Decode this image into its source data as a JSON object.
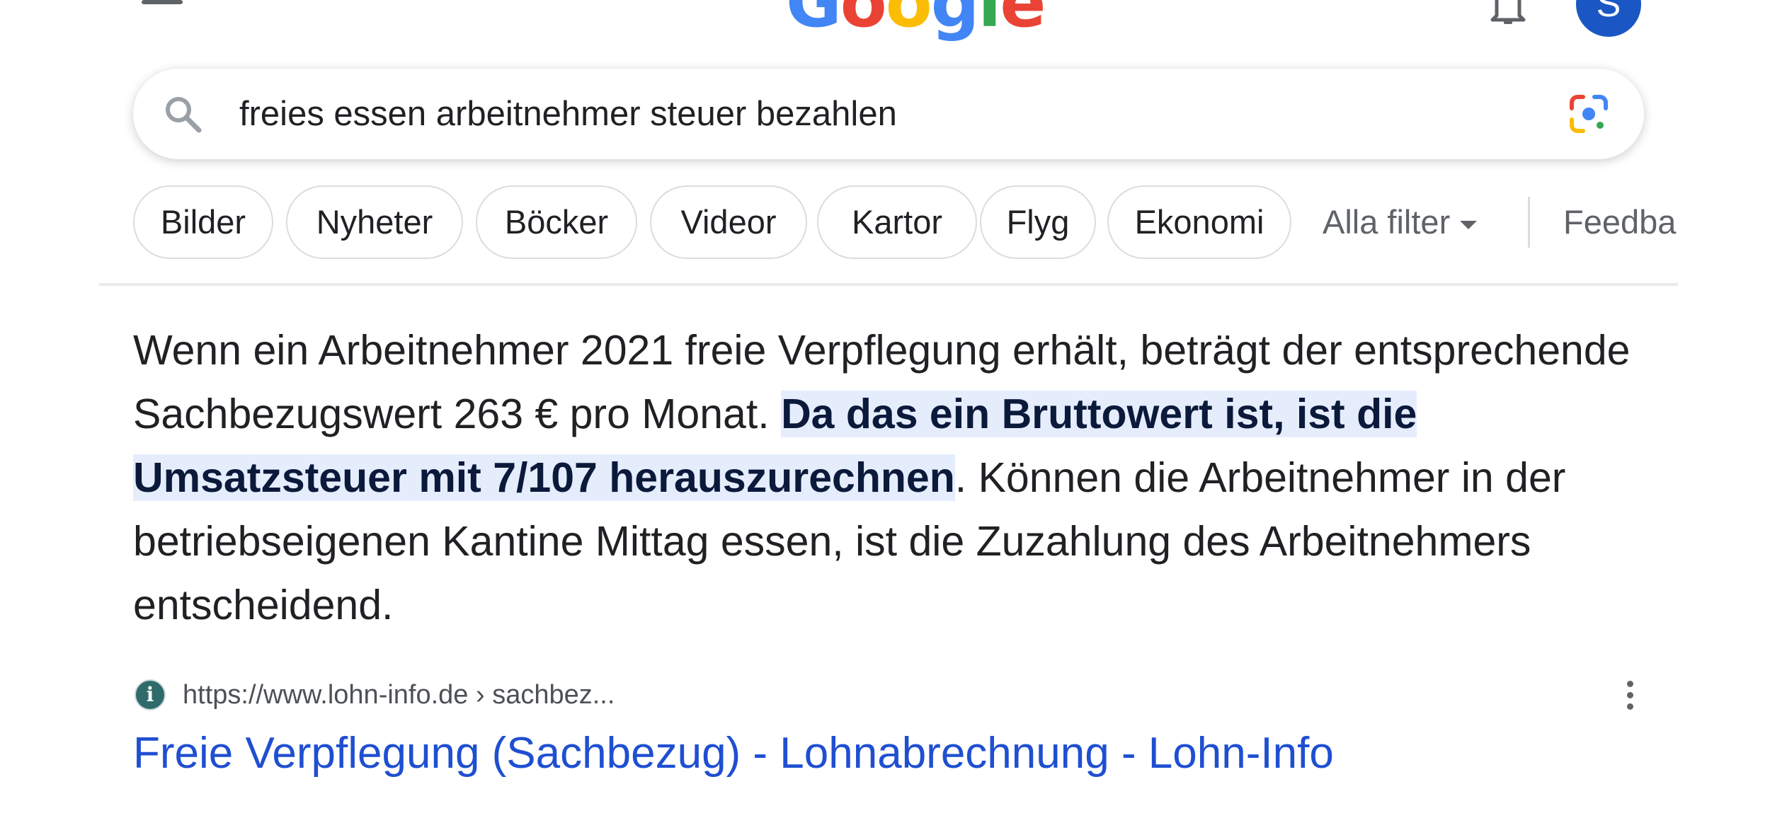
{
  "header": {
    "logo_letters": [
      "G",
      "o",
      "o",
      "g",
      "l",
      "e"
    ],
    "avatar_initial": "S"
  },
  "search": {
    "query": "freies essen arbeitnehmer steuer bezahlen"
  },
  "filters": {
    "chips": [
      "Bilder",
      "Nyheter",
      "Böcker",
      "Videor",
      "Kartor",
      "Flyg",
      "Ekonomi"
    ],
    "all_filters_label": "Alla filter",
    "feedback_label": "Feedba"
  },
  "snippet": {
    "text_before": "Wenn ein Arbeitnehmer 2021 freie Verpflegung erhält, beträgt der entsprechende Sachbezugswert 263 € pro Monat. ",
    "highlight": "Da das ein Bruttowert ist, ist die Umsatzsteuer mit 7/107 herauszurechnen",
    "text_after": ". Können die Arbeitnehmer in der betriebseigenen Kantine Mittag essen, ist die Zuzahlung des Arbeitnehmers entscheidend."
  },
  "result": {
    "favicon_letter": "i",
    "url": "https://www.lohn-info.de › sachbez...",
    "title": "Freie Verpflegung (Sachbezug) - Lohnabrechnung - Lohn-Info"
  },
  "colors": {
    "link": "#1f4fd1",
    "highlight_bg": "#e5edfd",
    "avatar_bg": "#1a57c4"
  },
  "icons": {
    "menu": "menu-icon",
    "bell": "bell-icon",
    "search": "search-icon",
    "lens": "google-lens-icon",
    "more": "more-vert-icon"
  }
}
